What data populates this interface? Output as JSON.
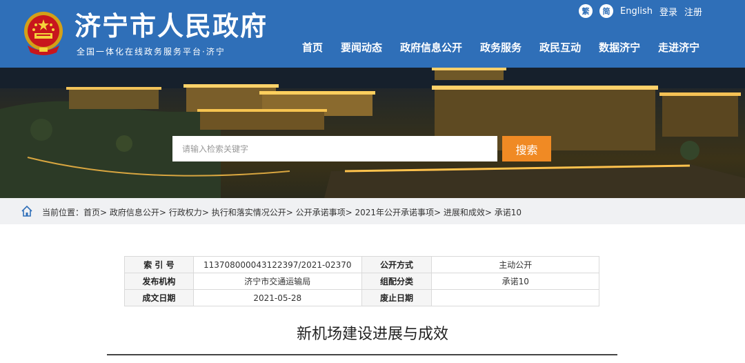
{
  "header": {
    "title": "济宁市人民政府",
    "subtitle": "全国一体化在线政务服务平台·济宁",
    "toplinks": {
      "traditional": "繁",
      "simplified": "简",
      "english": "English",
      "login": "登录",
      "register": "注册"
    },
    "nav": [
      "首页",
      "要闻动态",
      "政府信息公开",
      "政务服务",
      "政民互动",
      "数据济宁",
      "走进济宁"
    ]
  },
  "search": {
    "placeholder": "请输入检索关键字",
    "button": "搜索"
  },
  "breadcrumb": {
    "label": "当前位置：",
    "items": [
      "首页",
      "政府信息公开",
      "行政权力",
      "执行和落实情况公开",
      "公开承诺事项",
      "2021年公开承诺事项",
      "进展和成效",
      "承诺10"
    ]
  },
  "info": {
    "index_label": "索 引 号",
    "index_value": "113708000043122397/2021-02370",
    "method_label": "公开方式",
    "method_value": "主动公开",
    "org_label": "发布机构",
    "org_value": "济宁市交通运输局",
    "cat_label": "组配分类",
    "cat_value": "承诺10",
    "date_label": "成文日期",
    "date_value": "2021-05-28",
    "expire_label": "废止日期",
    "expire_value": ""
  },
  "article": {
    "title": "新机场建设进展与成效"
  },
  "colors": {
    "brand": "#2f6fb8",
    "accent": "#f08a24"
  }
}
